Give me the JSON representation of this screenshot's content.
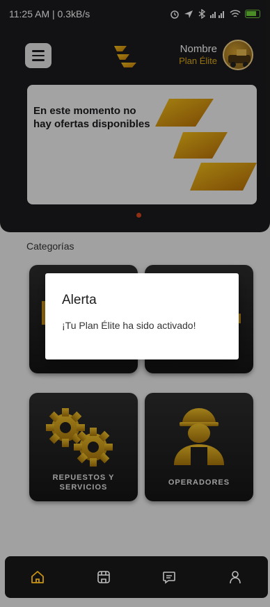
{
  "status_bar": {
    "time_speed": "11:25 AM | 0.3kB/s",
    "battery": "75"
  },
  "header": {
    "user_name": "Nombre",
    "plan": "Plan Élite"
  },
  "banner": {
    "text": "En este momento no hay ofertas disponibles"
  },
  "categories": {
    "title": "Categorías",
    "items": [
      {
        "label": ""
      },
      {
        "label": ""
      },
      {
        "label_line1": "REPUESTOS Y",
        "label_line2": "SERVICIOS"
      },
      {
        "label": "OPERADORES"
      }
    ]
  },
  "dialog": {
    "title": "Alerta",
    "message": "¡Tu Plan Élite ha sido activado!"
  },
  "bottom_nav": {
    "items": [
      "home-icon",
      "store-icon",
      "chat-icon",
      "profile-icon"
    ],
    "active_color": "#e0ad14"
  },
  "colors": {
    "accent": "#e0ad14",
    "dark": "#1c1c1e"
  }
}
